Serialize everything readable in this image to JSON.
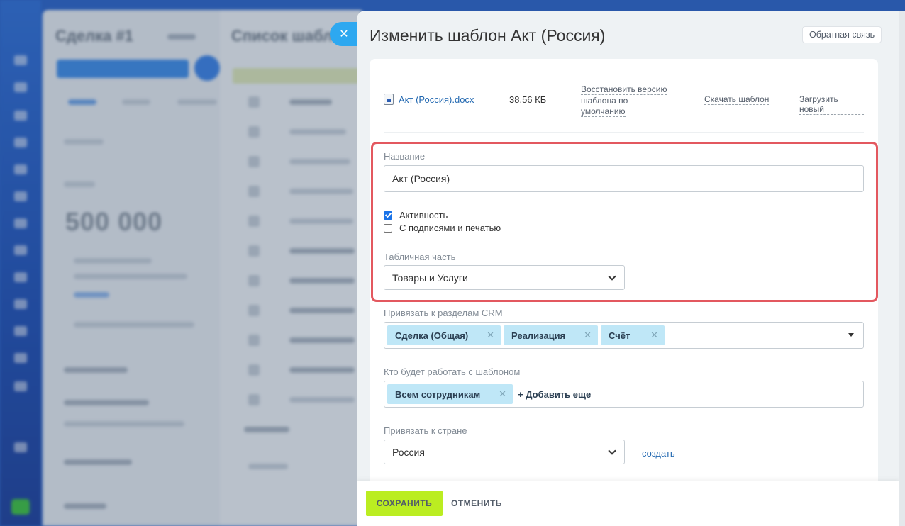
{
  "background": {
    "deal_title": "Сделка #1",
    "list_title": "Список шабл",
    "amount": "500 000"
  },
  "panel": {
    "title": "Изменить шаблон Акт (Россия)",
    "feedback_label": "Обратная связь",
    "close_icon": "close-icon"
  },
  "file": {
    "name": "Акт (Россия).docx",
    "size": "38.56 КБ",
    "restore_label": "Восстановить версию шаблона по умолчанию",
    "download_label": "Скачать шаблон",
    "upload_label": "Загрузить новый"
  },
  "form": {
    "name_label": "Название",
    "name_value": "Акт (Россия)",
    "active_label": "Активность",
    "active_checked": true,
    "stamps_label": "С подписями и печатью",
    "stamps_checked": false,
    "table_label": "Табличная часть",
    "table_value": "Товары и Услуги",
    "crm_label": "Привязать к разделам CRM",
    "crm_tags": [
      "Сделка (Общая)",
      "Реализация",
      "Счёт"
    ],
    "users_label": "Кто будет работать с шаблоном",
    "users_tags": [
      "Всем сотрудникам"
    ],
    "add_more_label": "+ Добавить еще",
    "country_label": "Привязать к стране",
    "country_value": "Россия",
    "create_label": "создать"
  },
  "footer": {
    "save_label": "СОХРАНИТЬ",
    "cancel_label": "ОТМЕНИТЬ"
  },
  "colors": {
    "accent": "#bbed21",
    "highlight": "#e3585f",
    "tag_bg": "#bfe7f7",
    "close_btn": "#2da8f0"
  }
}
